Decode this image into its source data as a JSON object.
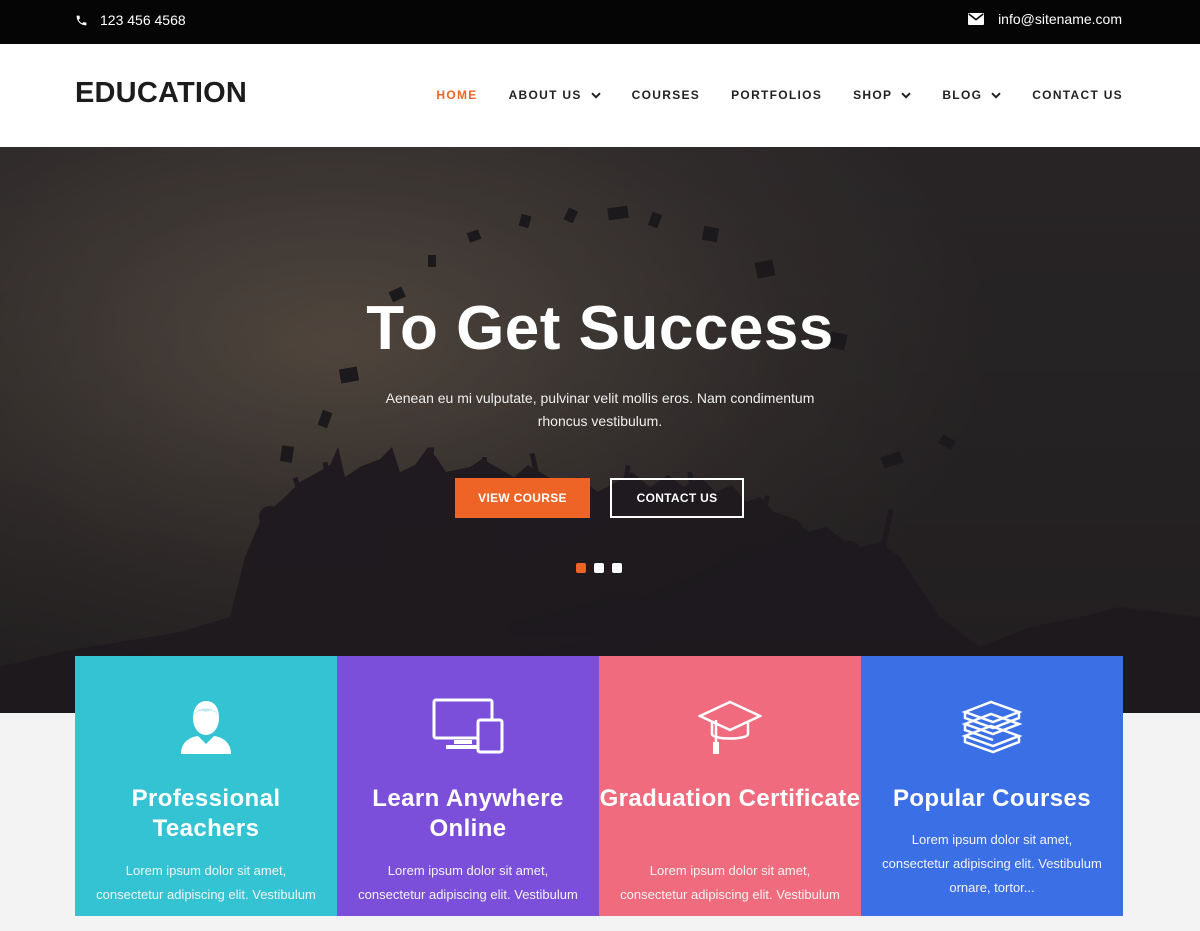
{
  "topbar": {
    "phone": "123 456 4568",
    "email": "info@sitename.com"
  },
  "header": {
    "logo": "EDUCATION",
    "nav": [
      {
        "label": "HOME",
        "active": true
      },
      {
        "label": "ABOUT US",
        "dropdown": true
      },
      {
        "label": "COURSES"
      },
      {
        "label": "PORTFOLIOS"
      },
      {
        "label": "SHOP",
        "dropdown": true
      },
      {
        "label": "BLOG",
        "dropdown": true
      },
      {
        "label": "CONTACT US"
      }
    ]
  },
  "hero": {
    "title": "To Get Success",
    "subtitle": "Aenean eu mi vulputate, pulvinar velit mollis eros. Nam condimentum rhoncus vestibulum.",
    "buttons": {
      "primary": "VIEW COURSE",
      "secondary": "CONTACT US"
    },
    "slides": {
      "count": 3,
      "active": 1
    }
  },
  "features": [
    {
      "title": "Professional Teachers",
      "text": "Lorem ipsum dolor sit amet, consectetur adipiscing elit. Vestibulum ornare,",
      "color": "#34c3d3",
      "icon": "teacher-icon"
    },
    {
      "title": "Learn Anywhere Online",
      "text": "Lorem ipsum dolor sit amet, consectetur adipiscing elit. Vestibulum ornare,",
      "color": "#7b4fd9",
      "icon": "devices-icon"
    },
    {
      "title": "Graduation Certificate",
      "text": "Lorem ipsum dolor sit amet, consectetur adipiscing elit. Vestibulum ornare,",
      "color": "#ef6b7d",
      "icon": "graduation-cap-icon"
    },
    {
      "title": "Popular Courses",
      "text": "Lorem ipsum dolor sit amet, consectetur adipiscing elit. Vestibulum ornare, tortor...",
      "color": "#3b6fe6",
      "icon": "books-icon"
    }
  ],
  "colors": {
    "accent": "#ee6427",
    "topbar": "#050505"
  }
}
